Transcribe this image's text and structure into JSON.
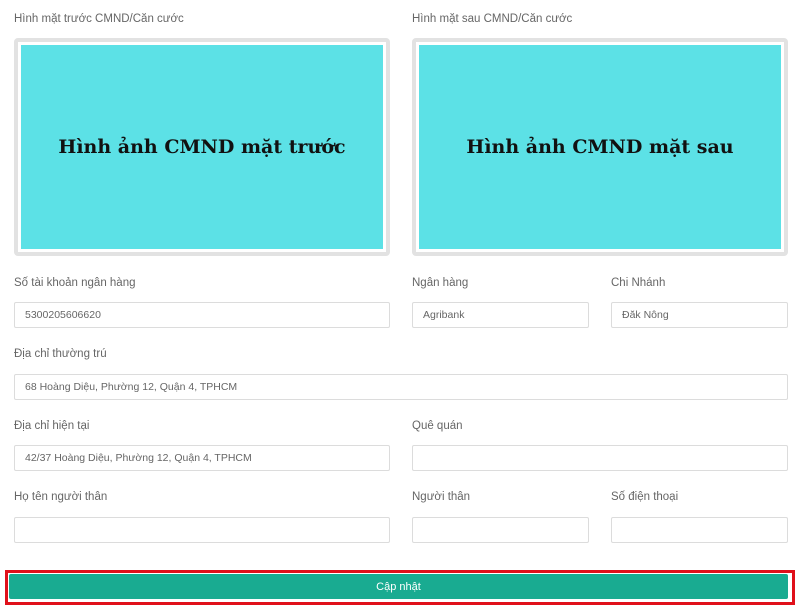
{
  "front_id": {
    "label": "Hình mặt trước CMND/Căn cước",
    "image_text": "Hình ảnh CMND mặt trước"
  },
  "back_id": {
    "label": "Hình mặt sau CMND/Căn cước",
    "image_text": "Hình ảnh CMND mặt sau"
  },
  "bank_account": {
    "label": "Số tài khoản ngân hàng",
    "value": "5300205606620"
  },
  "bank": {
    "label": "Ngân hàng",
    "value": "Agribank"
  },
  "branch": {
    "label": "Chi Nhánh",
    "value": "Đăk Nông"
  },
  "permanent_address": {
    "label": "Địa chỉ thường trú",
    "value": "68 Hoàng Diệu, Phường 12, Quận 4, TPHCM"
  },
  "current_address": {
    "label": "Địa chỉ hiện tại",
    "value": "42/37 Hoàng Diệu, Phường 12, Quận 4, TPHCM"
  },
  "hometown": {
    "label": "Quê quán",
    "value": ""
  },
  "relative_name": {
    "label": "Họ tên người thân",
    "value": ""
  },
  "relative": {
    "label": "Người thân",
    "value": ""
  },
  "phone": {
    "label": "Số điện thoại",
    "value": ""
  },
  "submit": {
    "label": "Cập nhật"
  },
  "colors": {
    "accent": "#19ab91",
    "highlight": "#e0101a",
    "id_image": "#5ce1e6"
  }
}
